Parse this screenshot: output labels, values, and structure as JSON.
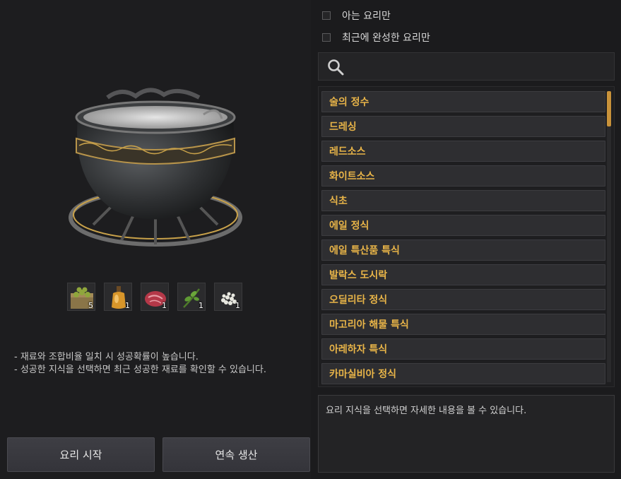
{
  "filters": {
    "known_only": "아는 요리만",
    "recent_only": "최근에 완성한 요리만"
  },
  "search": {
    "value": "",
    "placeholder": ""
  },
  "recipes": [
    "술의 정수",
    "드레싱",
    "레드소스",
    "화이트소스",
    "식초",
    "에일 정식",
    "에일 특산품 특식",
    "발락스 도시락",
    "오딜리타 정식",
    "마고리아 해물 특식",
    "아레하자 특식",
    "카마실비아 정식"
  ],
  "ingredients": [
    {
      "icon": "grain-crate-icon",
      "qty": "5"
    },
    {
      "icon": "oil-bottle-icon",
      "qty": "1"
    },
    {
      "icon": "raw-meat-icon",
      "qty": "1"
    },
    {
      "icon": "herb-sprig-icon",
      "qty": "1"
    },
    {
      "icon": "flour-pile-icon",
      "qty": "1"
    }
  ],
  "notes": {
    "line1": "- 재료와 조합비율 일치 시 성공확률이 높습니다.",
    "line2": "- 성공한 지식을 선택하면 최근 성공한 재료를 확인할 수 있습니다."
  },
  "buttons": {
    "start": "요리 시작",
    "continuous": "연속 생산"
  },
  "detail": {
    "text": "요리 지식을 선택하면 자세한 내용을 볼 수 있습니다."
  },
  "colors": {
    "recipe_text": "#e8b448",
    "scroll_thumb": "#c8923a",
    "background": "#1b1b1d"
  }
}
